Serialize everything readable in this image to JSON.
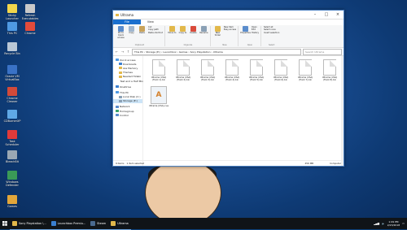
{
  "desktop": {
    "icons": [
      {
        "label": "Sticky Launcher",
        "color": "#f2d64b"
      },
      {
        "label": "Refresh Executables",
        "color": "#c9c9c9"
      },
      {
        "label": "This PC",
        "color": "#4f9ae3"
      },
      {
        "label": "Chrome",
        "color": "#e14b3c"
      },
      {
        "label": "Recycle Bin",
        "color": "#b9c7d6"
      },
      {
        "label": "Oracle VM VirtualBox",
        "color": "#3a72c6"
      },
      {
        "label": "Chrome Cleaner",
        "color": "#d24a3a"
      },
      {
        "label": "CDBurnerXP",
        "color": "#5fa8e6"
      },
      {
        "label": "Task Scheduler",
        "color": "#e23a3a"
      },
      {
        "label": "BleachBit",
        "color": "#9aa7b3"
      },
      {
        "label": "Windows Defender",
        "color": "#3a9a57"
      },
      {
        "label": "Games",
        "color": "#e2a63a"
      }
    ]
  },
  "window": {
    "title": "Ultrama",
    "tabs": [
      "File",
      "Home",
      "Share",
      "View"
    ],
    "ribbon": {
      "pin_label": "Pin to Quick access",
      "copy_label": "Copy",
      "paste_label": "Paste",
      "cut_label": "Cut",
      "copy_path_label": "Copy path",
      "paste_shortcut_label": "Paste shortcut",
      "clipboard_group": "Clipboard",
      "move_to_label": "Move to",
      "copy_to_label": "Copy to",
      "delete_label": "Delete",
      "rename_label": "Rename",
      "organize_group": "Organize",
      "new_folder_label": "New folder",
      "new_item_label": "New item",
      "easy_access_label": "Easy access",
      "new_group": "New",
      "properties_label": "Properties",
      "open_label": "Open",
      "edit_label": "Edit",
      "history_label": "History",
      "open_group": "Open",
      "select_all_label": "Select all",
      "select_none_label": "Select none",
      "invert_selection_label": "Invert selection",
      "select_group": "Select"
    },
    "address": {
      "path": [
        "This PC",
        "Storage (E:)",
        "Launchbox",
        "Games",
        "Sony Playstation",
        "Ultrama"
      ],
      "search_placeholder": "Search Ultrama"
    },
    "nav": [
      {
        "label": "Quick access",
        "color": "#4f9ae3",
        "level": 0
      },
      {
        "label": "Downloads",
        "color": "#3a7fd0",
        "level": 1
      },
      {
        "label": "Ass Memory",
        "color": "#e2b84a",
        "level": 1
      },
      {
        "label": "Themes",
        "color": "#e2b84a",
        "level": 1
      },
      {
        "label": "Needed Hidaki",
        "color": "#e2b84a",
        "level": 1
      },
      {
        "label": "Test and a Half Mix",
        "color": "#e2b84a",
        "level": 1
      },
      {
        "label": "OneDrive",
        "color": "#3a7fd0",
        "level": 0
      },
      {
        "label": "This PC",
        "color": "#4f9ae3",
        "level": 0
      },
      {
        "label": "Local Disk (C:)",
        "color": "#8aa0b5",
        "level": 1
      },
      {
        "label": "Storage (E:)",
        "color": "#8aa0b5",
        "level": 1
      },
      {
        "label": "Network",
        "color": "#5a8ccc",
        "level": 0
      },
      {
        "label": "Homegroup",
        "color": "#3aa36b",
        "level": 0
      },
      {
        "label": "Control",
        "color": "#5a8ccc",
        "level": 0
      }
    ],
    "files": [
      {
        "name": "Ultrama (USA) (Track 1).bin"
      },
      {
        "name": "Ultrama (USA) (Track 2).bin"
      },
      {
        "name": "Ultrama (USA) (Track 3).bin"
      },
      {
        "name": "Ultrama (USA) (Track 4).bin"
      },
      {
        "name": "Ultrama (USA) (Track 5).bin"
      },
      {
        "name": "Ultrama (USA) (Track 6).bin"
      },
      {
        "name": "Ultrama (USA) (Track 7).bin"
      },
      {
        "name": "Ultrama (USA) (Track 8).bin"
      },
      {
        "name": "Ultrama (USA).cue",
        "thumb": true
      }
    ],
    "status": {
      "items": "9 items",
      "selected": "1 item selected",
      "size": "456 MB",
      "location": "Computer"
    }
  },
  "taskbar": {
    "apps": [
      {
        "label": "Sony Playstation \\...",
        "color": "#e2b84a"
      },
      {
        "label": "Launchbox Premiu...",
        "color": "#3a7fd0"
      },
      {
        "label": "Steam",
        "color": "#4a6a90"
      },
      {
        "label": "Ultrama",
        "color": "#e2b84a"
      }
    ],
    "time": "1:09 PM",
    "date": "2/23/2018"
  }
}
